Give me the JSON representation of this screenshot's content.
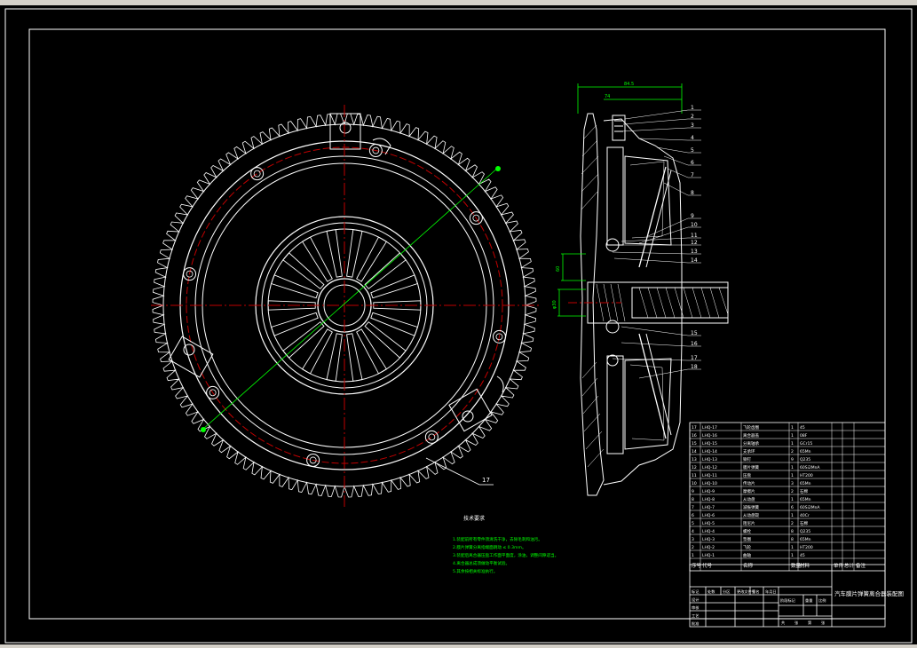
{
  "canvas": {
    "background": "#000000",
    "line_color": "#ffffff",
    "red_color": "#c00000",
    "green_color": "#00ff00"
  },
  "front_view": {
    "tooth_count": 120,
    "bolt_count": 8,
    "spring_finger_count": 18
  },
  "section_callouts": [
    "1",
    "2",
    "3",
    "4",
    "5",
    "6",
    "7",
    "8",
    "9",
    "10",
    "11",
    "12",
    "13",
    "14",
    "15",
    "16",
    "17",
    "18"
  ],
  "front_callout": "17",
  "dimensions": {
    "top": "84.5",
    "inner": "74",
    "left_vertical": "60",
    "shaft": "φ30"
  },
  "notes": {
    "title": "技术要求",
    "items": [
      "1.装配前所有零件须清洗干净，去除毛刺和油污。",
      "2.膜片弹簧分离指端面跳动 ≤ 0.3mm。",
      "3.装配后离合器压盘工作面平面度，涂油，调整间隙适当。",
      "4.离合器总成须做动平衡试验。",
      "5.其余按相关标准执行。"
    ]
  },
  "bom": {
    "rows": [
      {
        "code": "LHQ-17",
        "name": "飞轮齿圈",
        "qty": "1",
        "mat": "45"
      },
      {
        "code": "LHQ-16",
        "name": "离合器盖",
        "qty": "1",
        "mat": "08F"
      },
      {
        "code": "LHQ-15",
        "name": "分离轴承",
        "qty": "1",
        "mat": "GCr15"
      },
      {
        "code": "LHQ-14",
        "name": "支承环",
        "qty": "2",
        "mat": "65Mn"
      },
      {
        "code": "LHQ-13",
        "name": "铆钉",
        "qty": "9",
        "mat": "Q235"
      },
      {
        "code": "LHQ-12",
        "name": "膜片弹簧",
        "qty": "1",
        "mat": "60Si2MnA"
      },
      {
        "code": "LHQ-11",
        "name": "压盘",
        "qty": "1",
        "mat": "HT200"
      },
      {
        "code": "LHQ-10",
        "name": "传动片",
        "qty": "3",
        "mat": "65Mn"
      },
      {
        "code": "LHQ-9",
        "name": "摩擦片",
        "qty": "2",
        "mat": "石棉"
      },
      {
        "code": "LHQ-8",
        "name": "从动盘",
        "qty": "1",
        "mat": "65Mn"
      },
      {
        "code": "LHQ-7",
        "name": "减振弹簧",
        "qty": "6",
        "mat": "60Si2MnA"
      },
      {
        "code": "LHQ-6",
        "name": "从动盘毂",
        "qty": "1",
        "mat": "40Cr"
      },
      {
        "code": "LHQ-5",
        "name": "阻尼片",
        "qty": "2",
        "mat": "石棉"
      },
      {
        "code": "LHQ-4",
        "name": "螺栓",
        "qty": "8",
        "mat": "Q235"
      },
      {
        "code": "LHQ-3",
        "name": "垫圈",
        "qty": "8",
        "mat": "65Mn"
      },
      {
        "code": "LHQ-2",
        "name": "飞轮",
        "qty": "1",
        "mat": "HT200"
      },
      {
        "code": "LHQ-1",
        "name": "曲轴",
        "qty": "1",
        "mat": "45"
      }
    ],
    "header": [
      "序号",
      "代号",
      "名称",
      "数量",
      "材料",
      "单件",
      "总计",
      "备注"
    ]
  },
  "title_block": {
    "drawing_title": "汽车膜片弹簧离合器装配图",
    "cells": [
      "标记",
      "处数",
      "分区",
      "更改文件号",
      "签名",
      "年月日",
      "设计",
      "审核",
      "工艺",
      "批准",
      "阶段标记",
      "重量",
      "比例",
      "共",
      "张",
      "第",
      "张"
    ]
  }
}
